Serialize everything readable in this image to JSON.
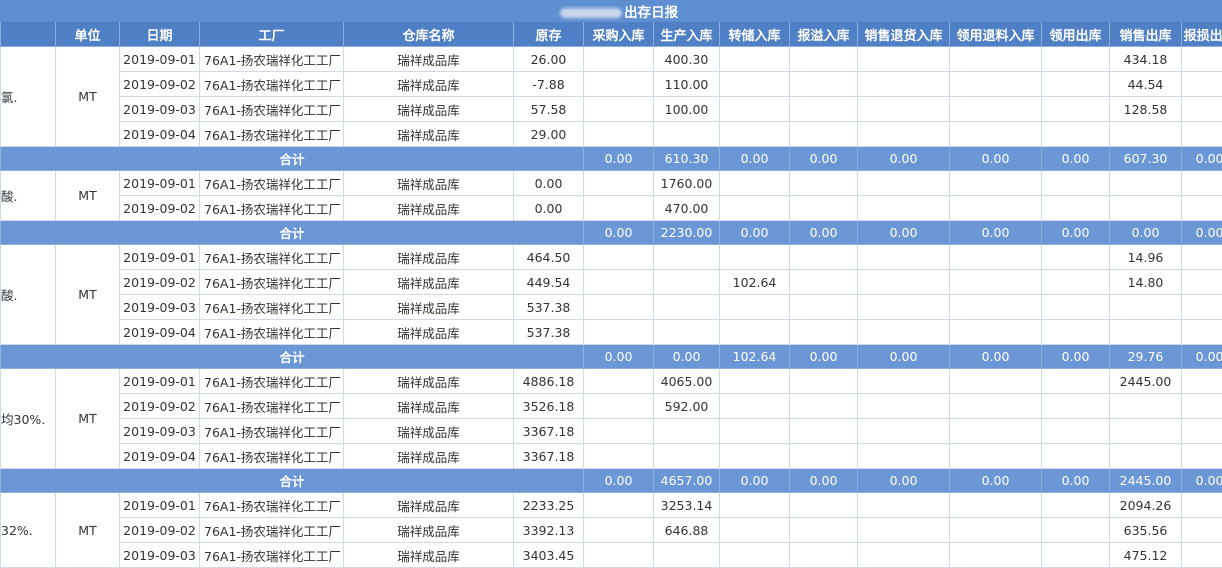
{
  "report": {
    "title": "出存日报"
  },
  "columns": [
    "",
    "单位",
    "日期",
    "工厂",
    "仓库名称",
    "原存",
    "采购入库",
    "生产入库",
    "转储入库",
    "报溢入库",
    "销售退货入库",
    "领用退料入库",
    "领用出库",
    "销售出库",
    "报损出库"
  ],
  "groups": [
    {
      "product": "氯.",
      "unit": "MT",
      "rows": [
        {
          "date": "2019-09-01",
          "factory": "76A1-扬农瑞祥化工工厂",
          "warehouse": "瑞祥成品库",
          "cells": [
            "26.00",
            "",
            "400.30",
            "",
            "",
            "",
            "",
            "",
            "434.18",
            ""
          ]
        },
        {
          "date": "2019-09-02",
          "factory": "76A1-扬农瑞祥化工工厂",
          "warehouse": "瑞祥成品库",
          "cells": [
            "-7.88",
            "",
            "110.00",
            "",
            "",
            "",
            "",
            "",
            "44.54",
            ""
          ]
        },
        {
          "date": "2019-09-03",
          "factory": "76A1-扬农瑞祥化工工厂",
          "warehouse": "瑞祥成品库",
          "cells": [
            "57.58",
            "",
            "100.00",
            "",
            "",
            "",
            "",
            "",
            "128.58",
            ""
          ]
        },
        {
          "date": "2019-09-04",
          "factory": "76A1-扬农瑞祥化工工厂",
          "warehouse": "瑞祥成品库",
          "cells": [
            "29.00",
            "",
            "",
            "",
            "",
            "",
            "",
            "",
            "",
            ""
          ]
        }
      ],
      "subtotal": {
        "label": "合计",
        "cells": [
          "0.00",
          "610.30",
          "0.00",
          "0.00",
          "0.00",
          "0.00",
          "0.00",
          "607.30",
          "0.00"
        ]
      }
    },
    {
      "product": "酸.",
      "unit": "MT",
      "rows": [
        {
          "date": "2019-09-01",
          "factory": "76A1-扬农瑞祥化工工厂",
          "warehouse": "瑞祥成品库",
          "cells": [
            "0.00",
            "",
            "1760.00",
            "",
            "",
            "",
            "",
            "",
            "",
            ""
          ]
        },
        {
          "date": "2019-09-02",
          "factory": "76A1-扬农瑞祥化工工厂",
          "warehouse": "瑞祥成品库",
          "cells": [
            "0.00",
            "",
            "470.00",
            "",
            "",
            "",
            "",
            "",
            "",
            ""
          ]
        }
      ],
      "subtotal": {
        "label": "合计",
        "cells": [
          "0.00",
          "2230.00",
          "0.00",
          "0.00",
          "0.00",
          "0.00",
          "0.00",
          "0.00",
          "0.00"
        ]
      }
    },
    {
      "product": "酸.",
      "unit": "MT",
      "rows": [
        {
          "date": "2019-09-01",
          "factory": "76A1-扬农瑞祥化工工厂",
          "warehouse": "瑞祥成品库",
          "cells": [
            "464.50",
            "",
            "",
            "",
            "",
            "",
            "",
            "",
            "14.96",
            ""
          ]
        },
        {
          "date": "2019-09-02",
          "factory": "76A1-扬农瑞祥化工工厂",
          "warehouse": "瑞祥成品库",
          "cells": [
            "449.54",
            "",
            "",
            "102.64",
            "",
            "",
            "",
            "",
            "14.80",
            ""
          ]
        },
        {
          "date": "2019-09-03",
          "factory": "76A1-扬农瑞祥化工工厂",
          "warehouse": "瑞祥成品库",
          "cells": [
            "537.38",
            "",
            "",
            "",
            "",
            "",
            "",
            "",
            "",
            ""
          ]
        },
        {
          "date": "2019-09-04",
          "factory": "76A1-扬农瑞祥化工工厂",
          "warehouse": "瑞祥成品库",
          "cells": [
            "537.38",
            "",
            "",
            "",
            "",
            "",
            "",
            "",
            "",
            ""
          ]
        }
      ],
      "subtotal": {
        "label": "合计",
        "cells": [
          "0.00",
          "0.00",
          "102.64",
          "0.00",
          "0.00",
          "0.00",
          "0.00",
          "29.76",
          "0.00"
        ]
      }
    },
    {
      "product": "均30%.",
      "unit": "MT",
      "rows": [
        {
          "date": "2019-09-01",
          "factory": "76A1-扬农瑞祥化工工厂",
          "warehouse": "瑞祥成品库",
          "cells": [
            "4886.18",
            "",
            "4065.00",
            "",
            "",
            "",
            "",
            "",
            "2445.00",
            ""
          ]
        },
        {
          "date": "2019-09-02",
          "factory": "76A1-扬农瑞祥化工工厂",
          "warehouse": "瑞祥成品库",
          "cells": [
            "3526.18",
            "",
            "592.00",
            "",
            "",
            "",
            "",
            "",
            "",
            ""
          ]
        },
        {
          "date": "2019-09-03",
          "factory": "76A1-扬农瑞祥化工工厂",
          "warehouse": "瑞祥成品库",
          "cells": [
            "3367.18",
            "",
            "",
            "",
            "",
            "",
            "",
            "",
            "",
            ""
          ]
        },
        {
          "date": "2019-09-04",
          "factory": "76A1-扬农瑞祥化工工厂",
          "warehouse": "瑞祥成品库",
          "cells": [
            "3367.18",
            "",
            "",
            "",
            "",
            "",
            "",
            "",
            "",
            ""
          ]
        }
      ],
      "subtotal": {
        "label": "合计",
        "cells": [
          "0.00",
          "4657.00",
          "0.00",
          "0.00",
          "0.00",
          "0.00",
          "0.00",
          "2445.00",
          "0.00"
        ]
      }
    },
    {
      "product": "32%.",
      "unit": "MT",
      "rows": [
        {
          "date": "2019-09-01",
          "factory": "76A1-扬农瑞祥化工工厂",
          "warehouse": "瑞祥成品库",
          "cells": [
            "2233.25",
            "",
            "3253.14",
            "",
            "",
            "",
            "",
            "",
            "2094.26",
            ""
          ]
        },
        {
          "date": "2019-09-02",
          "factory": "76A1-扬农瑞祥化工工厂",
          "warehouse": "瑞祥成品库",
          "cells": [
            "3392.13",
            "",
            "646.88",
            "",
            "",
            "",
            "",
            "",
            "635.56",
            ""
          ]
        },
        {
          "date": "2019-09-03",
          "factory": "76A1-扬农瑞祥化工工厂",
          "warehouse": "瑞祥成品库",
          "cells": [
            "3403.45",
            "",
            "",
            "",
            "",
            "",
            "",
            "",
            "475.12",
            ""
          ]
        }
      ],
      "subtotal": null
    }
  ]
}
